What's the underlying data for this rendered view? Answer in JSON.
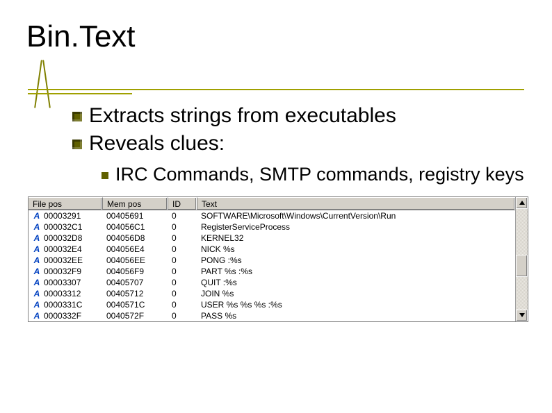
{
  "title": "Bin.Text",
  "bullets": {
    "b1": "Extracts strings from executables",
    "b2": "Reveals clues:",
    "b2a": "IRC Commands, SMTP commands, registry keys"
  },
  "grid": {
    "headers": {
      "fp": "File pos",
      "mp": "Mem pos",
      "id": "ID",
      "tx": "Text"
    },
    "rows": [
      {
        "fp": "00003291",
        "mp": "00405691",
        "id": "0",
        "tx": "SOFTWARE\\Microsoft\\Windows\\CurrentVersion\\Run"
      },
      {
        "fp": "000032C1",
        "mp": "004056C1",
        "id": "0",
        "tx": "RegisterServiceProcess"
      },
      {
        "fp": "000032D8",
        "mp": "004056D8",
        "id": "0",
        "tx": "KERNEL32"
      },
      {
        "fp": "000032E4",
        "mp": "004056E4",
        "id": "0",
        "tx": "NICK %s"
      },
      {
        "fp": "000032EE",
        "mp": "004056EE",
        "id": "0",
        "tx": "PONG :%s"
      },
      {
        "fp": "000032F9",
        "mp": "004056F9",
        "id": "0",
        "tx": "PART %s :%s"
      },
      {
        "fp": "00003307",
        "mp": "00405707",
        "id": "0",
        "tx": "QUIT :%s"
      },
      {
        "fp": "00003312",
        "mp": "00405712",
        "id": "0",
        "tx": "JOIN %s"
      },
      {
        "fp": "0000331C",
        "mp": "0040571C",
        "id": "0",
        "tx": "USER %s %s %s :%s"
      },
      {
        "fp": "0000332F",
        "mp": "0040572F",
        "id": "0",
        "tx": "PASS %s"
      }
    ],
    "icon_label": "A"
  }
}
